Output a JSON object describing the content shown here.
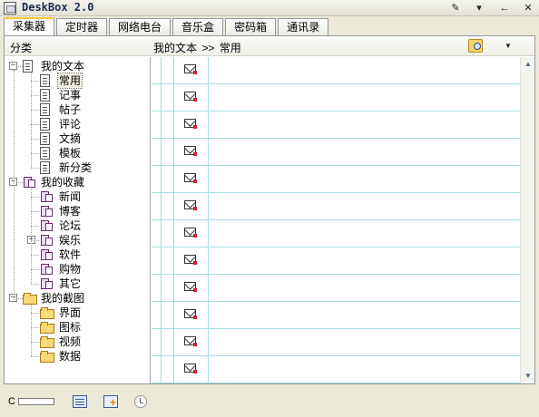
{
  "window": {
    "title": "DeskBox 2.0",
    "controls": [
      "pin-icon",
      "menu-down-icon",
      "minimize-icon",
      "close-icon"
    ]
  },
  "tabs": [
    {
      "label": "采集器",
      "active": true
    },
    {
      "label": "定时器",
      "active": false
    },
    {
      "label": "网络电台",
      "active": false
    },
    {
      "label": "音乐盒",
      "active": false
    },
    {
      "label": "密码箱",
      "active": false
    },
    {
      "label": "通讯录",
      "active": false
    }
  ],
  "header": {
    "category_label": "分类",
    "breadcrumb": {
      "root": "我的文本",
      "separator": ">>",
      "current": "常用"
    },
    "search_icon": "search-icon",
    "dropdown_icon": "chevron-down-icon"
  },
  "tree": {
    "groups": [
      {
        "label": "我的文本",
        "icon": "document-icon",
        "expanded": true,
        "children": [
          {
            "label": "常用",
            "selected": true
          },
          {
            "label": "记事"
          },
          {
            "label": "帖子"
          },
          {
            "label": "评论"
          },
          {
            "label": "文摘"
          },
          {
            "label": "模板"
          },
          {
            "label": "新分类"
          }
        ]
      },
      {
        "label": "我的收藏",
        "icon": "favorite-page-icon",
        "expanded": true,
        "children": [
          {
            "label": "新闻"
          },
          {
            "label": "博客"
          },
          {
            "label": "论坛"
          },
          {
            "label": "娱乐",
            "collapsed_expander": true
          },
          {
            "label": "软件"
          },
          {
            "label": "购物"
          },
          {
            "label": "其它"
          }
        ]
      },
      {
        "label": "我的截图",
        "icon": "folder-icon",
        "expanded": true,
        "children": [
          {
            "label": "界面"
          },
          {
            "label": "图标"
          },
          {
            "label": "视频"
          },
          {
            "label": "数据"
          }
        ]
      }
    ]
  },
  "grid": {
    "row_count": 12,
    "row_icon": "mail-icon"
  },
  "statusbar": {
    "label": "C",
    "progress": 0,
    "icons": [
      "keyboard-icon",
      "add-item-icon",
      "clock-icon"
    ]
  }
}
